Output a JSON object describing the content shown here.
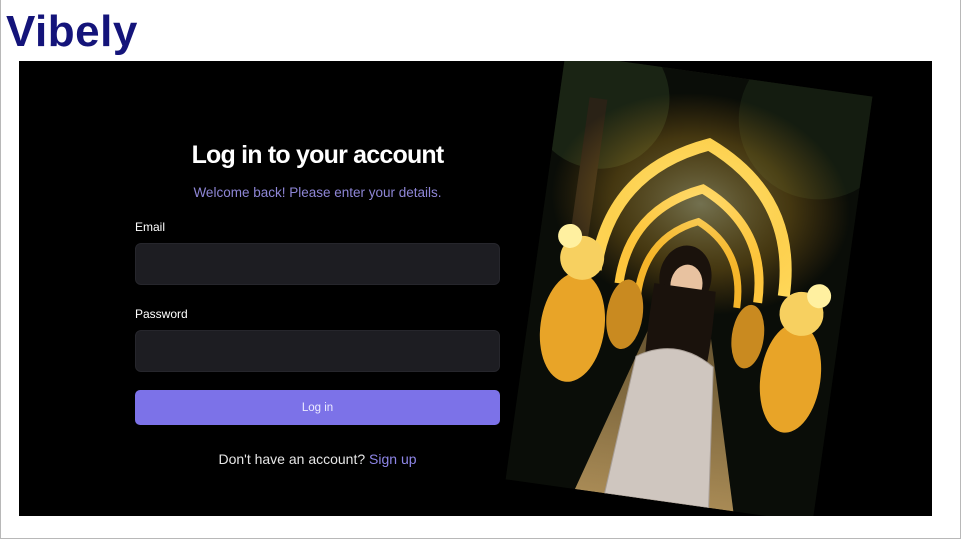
{
  "app": {
    "brand": "Vibely"
  },
  "login": {
    "title": "Log in to your account",
    "subtitle": "Welcome back! Please enter your details.",
    "email_label": "Email",
    "email_value": "",
    "password_label": "Password",
    "password_value": "",
    "login_button": "Log in",
    "signup_prompt": "Don't have an account?",
    "signup_link": "Sign up"
  },
  "colors": {
    "brand": "#14147a",
    "background": "#000000",
    "accent": "#7c72e8",
    "subtitle": "#8e86d6",
    "input_bg": "#1d1d22"
  },
  "photo": {
    "subject": "photo-person-lantern-arches"
  }
}
